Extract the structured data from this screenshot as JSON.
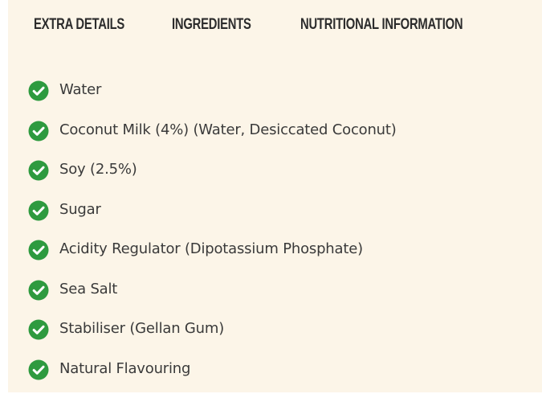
{
  "tabs": {
    "extra_details": "EXTRA DETAILS",
    "ingredients": "INGREDIENTS",
    "nutritional_information": "NUTRITIONAL INFORMATION"
  },
  "ingredients": [
    "Water",
    "Coconut Milk (4%) (Water, Desiccated Coconut)",
    "Soy (2.5%)",
    "Sugar",
    "Acidity Regulator (Dipotassium Phosphate)",
    "Sea Salt",
    "Stabiliser (Gellan Gum)",
    "Natural Flavouring"
  ],
  "icons": {
    "item_icon": "check-circle-icon"
  },
  "colors": {
    "panel_background": "#fcf5e8",
    "check_green": "#2e9a3f",
    "text": "#3a3a3a"
  }
}
